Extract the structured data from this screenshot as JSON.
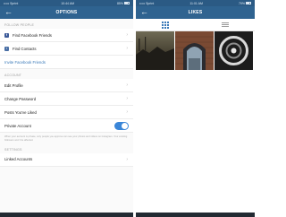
{
  "left_screen": {
    "status": {
      "carrier": "••••• Sprint",
      "time": "10:44 AM",
      "battery": "85%",
      "battery_level": 0.85
    },
    "nav": {
      "back_icon": "back-arrow-icon",
      "title": "OPTIONS"
    },
    "follow_people": {
      "header": "FOLLOW PEOPLE",
      "items": [
        {
          "label": "Find Facebook Friends",
          "icon": "facebook-icon",
          "icon_glyph": "f"
        },
        {
          "label": "Find Contacts",
          "icon": "contacts-icon",
          "icon_glyph": "▪"
        }
      ],
      "invite_label": "Invite Facebook Friends"
    },
    "account": {
      "header": "ACCOUNT",
      "items": [
        {
          "label": "Edit Profile"
        },
        {
          "label": "Change Password"
        },
        {
          "label": "Posts You've Liked"
        }
      ],
      "private": {
        "label": "Private Account",
        "enabled": true
      },
      "note": "When your account is private, only people you approve can see your photos and videos on Instagram. Your existing followers won't be affected."
    },
    "settings": {
      "header": "SETTINGS",
      "items": [
        {
          "label": "Linked Accounts"
        }
      ]
    }
  },
  "right_screen": {
    "status": {
      "carrier": "••••• Sprint",
      "time": "11:01 AM",
      "battery": "79%",
      "battery_level": 0.79
    },
    "nav": {
      "back_icon": "back-arrow-icon",
      "title": "LIKES"
    },
    "tabs": [
      {
        "name": "grid-view",
        "icon": "grid-icon",
        "active": true
      },
      {
        "name": "list-view",
        "icon": "list-icon",
        "active": false
      }
    ],
    "photos": [
      {
        "name": "liked-photo-1",
        "description": "dark landscape"
      },
      {
        "name": "liked-photo-2",
        "description": "brick arch"
      },
      {
        "name": "liked-photo-3",
        "description": "circle graphic"
      }
    ]
  },
  "colors": {
    "nav": "#2f6390",
    "status": "#2b5a84",
    "accent": "#3a86d8",
    "link": "#3a79b8"
  }
}
